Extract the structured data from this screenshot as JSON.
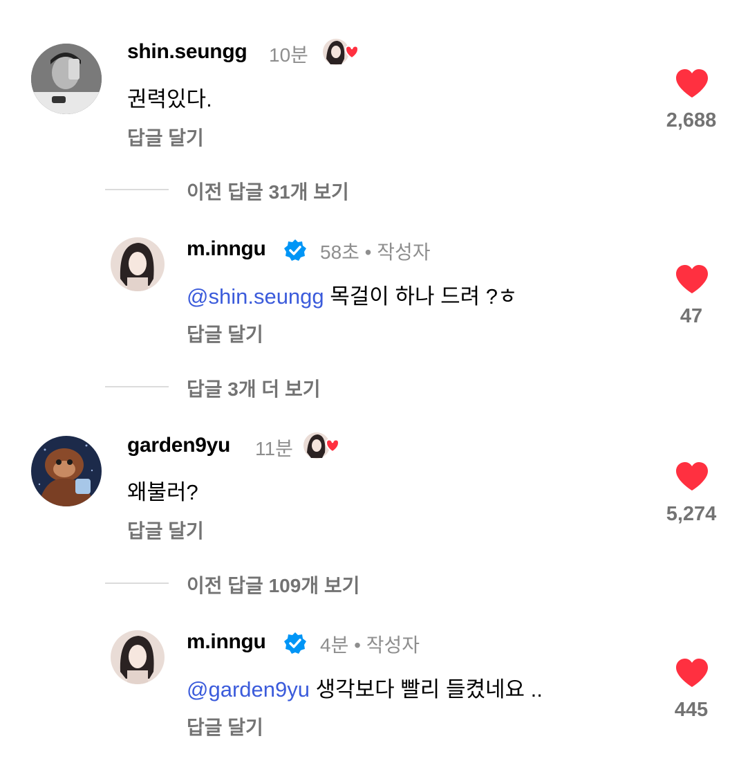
{
  "comments": [
    {
      "username": "shin.seungg",
      "time": "10분",
      "text": "권력있다.",
      "reply_label": "답글 달기",
      "likes": "2,688",
      "author_liked": true
    },
    {
      "username": "m.inngu",
      "verified": true,
      "time": "58초 • 작성자",
      "mention": "@shin.seungg",
      "text": " 목걸이 하나 드려 ?ㅎ",
      "reply_label": "답글 달기",
      "likes": "47"
    },
    {
      "username": "garden9yu",
      "time": "11분",
      "text": "왜불러?",
      "reply_label": "답글 달기",
      "likes": "5,274",
      "author_liked": true
    },
    {
      "username": "m.inngu",
      "verified": true,
      "time": "4분 • 작성자",
      "mention": "@garden9yu",
      "text": " 생각보다 빨리 들켰네요 ..",
      "reply_label": "답글 달기",
      "likes": "445"
    }
  ],
  "view_more": [
    "이전 답글 31개 보기",
    "답글 3개 더 보기",
    "이전 답글 109개 보기"
  ],
  "colors": {
    "heart": "#ff3040",
    "verified": "#0095f6",
    "mention": "#3b5bdb",
    "secondary_text": "#737373"
  }
}
